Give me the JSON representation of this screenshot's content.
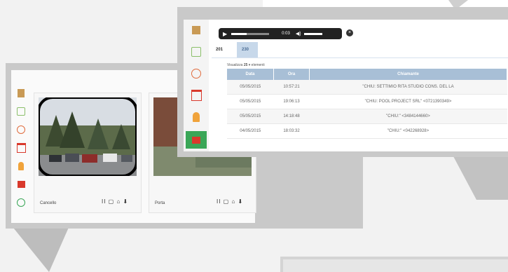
{
  "cameras": [
    {
      "label": "Cancello",
      "controls": "II ▢ ⌂ ⬇"
    },
    {
      "label": "Porta",
      "controls": "II ▢ ⌂ ⬇"
    }
  ],
  "player": {
    "time": "0:03"
  },
  "tabs": [
    {
      "label": "201"
    },
    {
      "label": "230"
    }
  ],
  "visualizza": {
    "prefix": "Visualizza",
    "count": "25",
    "suffix": "elementi"
  },
  "table": {
    "headers": [
      "Data",
      "Ora",
      "Chiamante"
    ],
    "rows": [
      [
        "05/05/2015",
        "10:57:21",
        "\"CHIU: SETTIMIO RITA STUDIO CONS. DEL LA"
      ],
      [
        "05/05/2015",
        "19:06:13",
        "\"CHIU: POOL PROJECT SRL\" <0721390349>"
      ],
      [
        "05/05/2015",
        "14:18:48",
        "\"CHIU:\" <3484144660>"
      ],
      [
        "04/05/2015",
        "18:03:32",
        "\"CHIU:\" <042268928>"
      ]
    ]
  },
  "colors": {
    "background": "#f2f2f2",
    "card_grey": "#c9c9c9",
    "table_header": "#a8bfd6",
    "tab_active": "#c7d8ea",
    "sidebar_red": "#d9392c",
    "sidebar_green": "#3aa657",
    "sidebar_orange": "#f0a33b"
  }
}
